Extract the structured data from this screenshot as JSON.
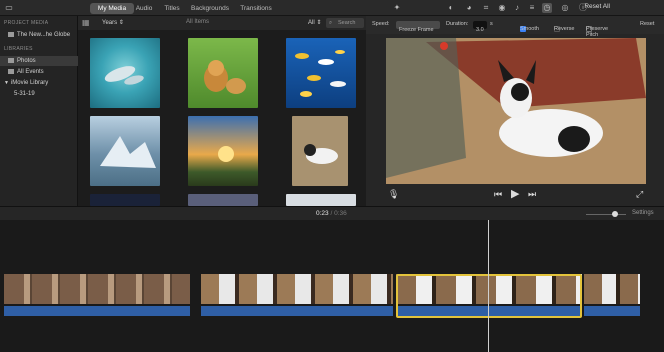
{
  "tabs": [
    {
      "label": "My Media",
      "active": true
    },
    {
      "label": "Audio",
      "active": false
    },
    {
      "label": "Titles",
      "active": false
    },
    {
      "label": "Backgrounds",
      "active": false
    },
    {
      "label": "Transitions",
      "active": false
    }
  ],
  "toolbar": {
    "reset_all": "Reset All"
  },
  "sidebar": {
    "project_media_heading": "PROJECT MEDIA",
    "project_item": "The New...he Globe",
    "libraries_heading": "LIBRARIES",
    "items": [
      {
        "label": "Photos",
        "selected": true
      },
      {
        "label": "All Events",
        "selected": false
      },
      {
        "label": "iMovie Library",
        "selected": false
      },
      {
        "label": "5-31-19",
        "selected": false
      }
    ]
  },
  "browser": {
    "years_label": "Years",
    "all_items_label": "All Items",
    "all_label": "All",
    "search_placeholder": "Search"
  },
  "viewer": {
    "speed_label": "Speed:",
    "speed_value": "Freeze Frame",
    "duration_label": "Duration:",
    "duration_value": "3.0",
    "duration_unit": "s",
    "smooth_label": "Smooth",
    "reverse_label": "Reverse",
    "preserve_pitch_label": "Preserve Pitch",
    "reset_label": "Reset"
  },
  "timeline": {
    "current_time": "0:23",
    "separator": "/",
    "total_time": "0:36",
    "settings_label": "Settings"
  },
  "colors": {
    "accent_tab": "#555555",
    "selection": "#e3c33b",
    "audio_track": "#2f5fa6",
    "checkbox_blue": "#3b82f6"
  }
}
